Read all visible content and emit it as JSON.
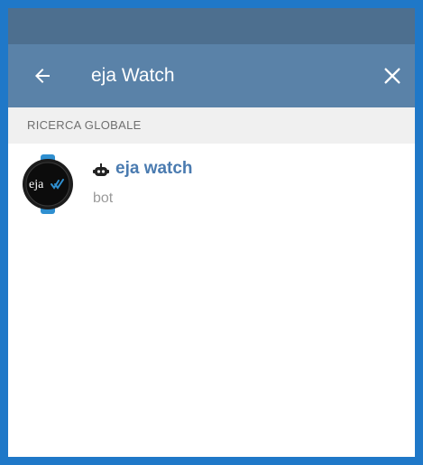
{
  "header": {
    "search_value": "eja Watch"
  },
  "section": {
    "title": "RICERCA GLOBALE"
  },
  "results": [
    {
      "name": "eja watch",
      "subtitle": "bot",
      "avatar_text": "eja",
      "icon": "bot-icon"
    }
  ],
  "colors": {
    "border": "#1f78c8",
    "status_bar": "#4d6f8f",
    "app_bar": "#5a82a8",
    "section_bg": "#f0f0f0",
    "title_link": "#4a7bb0",
    "subtitle_text": "#9a9a9a"
  },
  "icons": {
    "back": "arrow-left-icon",
    "close": "close-icon",
    "bot": "bot-icon"
  }
}
